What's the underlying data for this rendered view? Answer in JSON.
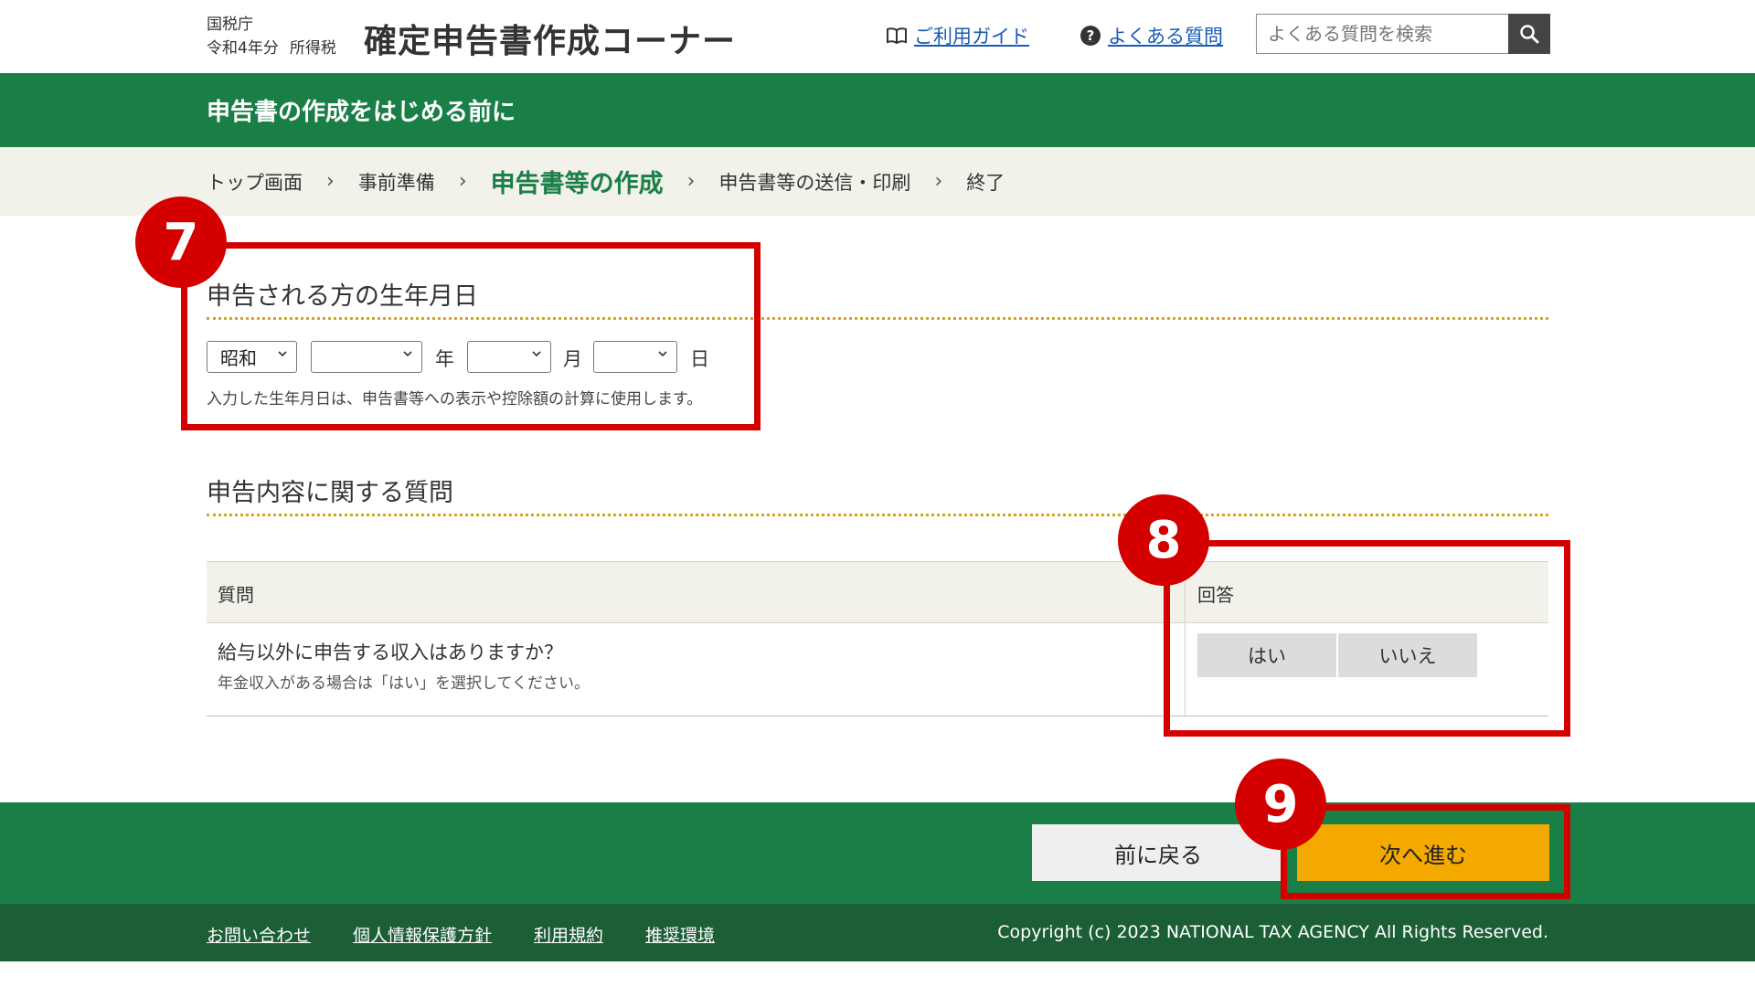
{
  "header": {
    "agency": "国税庁",
    "year": "令和4年分",
    "tax_type": "所得税",
    "site_title": "確定申告書作成コーナー",
    "guide_link": "ご利用ガイド",
    "faq_link": "よくある質問",
    "search_placeholder": "よくある質問を検索"
  },
  "page_title": "申告書の作成をはじめる前に",
  "breadcrumb": [
    "トップ画面",
    "事前準備",
    "申告書等の作成",
    "申告書等の送信・印刷",
    "終了"
  ],
  "birthdate": {
    "title": "申告される方の生年月日",
    "era_value": "昭和",
    "year_value": "",
    "month_value": "",
    "day_value": "",
    "year_unit": "年",
    "month_unit": "月",
    "day_unit": "日",
    "hint": "入力した生年月日は、申告書等への表示や控除額の計算に使用します。"
  },
  "questions": {
    "title": "申告内容に関する質問",
    "col_question": "質問",
    "col_answer": "回答",
    "q1_text": "給与以外に申告する収入はありますか？",
    "q1_sub": "年金収入がある場合は「はい」を選択してください。",
    "yes_label": "はい",
    "no_label": "いいえ"
  },
  "nav": {
    "back_label": "前に戻る",
    "next_label": "次へ進む"
  },
  "footer": {
    "links": [
      "お問い合わせ",
      "個人情報保護方針",
      "利用規約",
      "推奨環境"
    ],
    "copyright": "Copyright (c) 2023 NATIONAL TAX AGENCY All Rights Reserved."
  },
  "annotations": {
    "badge_7": "7",
    "badge_8": "8",
    "badge_9": "9",
    "color": "#d40000"
  },
  "colors": {
    "brand_green": "#1a7f47",
    "footer_green": "#1c5e35",
    "accent_yellow": "#f3a900",
    "link_blue": "#1a5bb5"
  }
}
